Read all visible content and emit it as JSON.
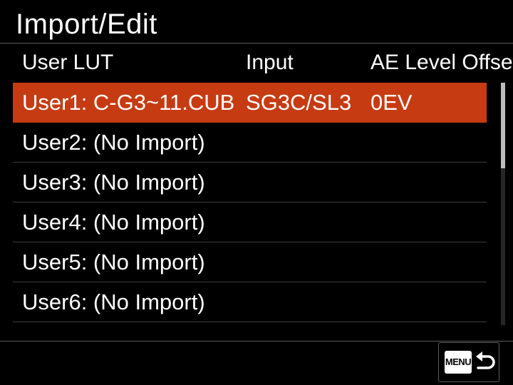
{
  "title": "Import/Edit",
  "columns": {
    "lut": "User LUT",
    "input": "Input",
    "ae": "AE Level Offset"
  },
  "rows": [
    {
      "lut": "User1: C-G3~11.CUB",
      "input": "SG3C/SL3",
      "ae": "0EV",
      "selected": true
    },
    {
      "lut": "User2: (No Import)",
      "input": "",
      "ae": "",
      "selected": false
    },
    {
      "lut": "User3: (No Import)",
      "input": "",
      "ae": "",
      "selected": false
    },
    {
      "lut": "User4: (No Import)",
      "input": "",
      "ae": "",
      "selected": false
    },
    {
      "lut": "User5: (No Import)",
      "input": "",
      "ae": "",
      "selected": false
    },
    {
      "lut": "User6: (No Import)",
      "input": "",
      "ae": "",
      "selected": false
    }
  ],
  "back_button": {
    "menu_label": "MENU",
    "icon": "return-arrow-icon"
  },
  "colors": {
    "selection": "#c63b12",
    "background": "#000000",
    "text": "#ffffff"
  }
}
